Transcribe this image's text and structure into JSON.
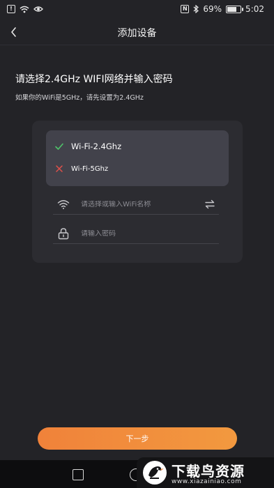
{
  "status_bar": {
    "time": "5:02",
    "battery_text": "69%"
  },
  "header": {
    "title": "添加设备"
  },
  "instructions": {
    "heading": "请选择2.4GHz WIFI网络并输入密码",
    "subheading": "如果你的WiFi是5GHz，请先设置为2.4GHz"
  },
  "network_options": [
    {
      "label": "Wi-Fi-2.4Ghz",
      "status": "supported",
      "icon": "check-icon"
    },
    {
      "label": "Wi-Fi-5Ghz",
      "status": "unsupported",
      "icon": "cross-icon"
    }
  ],
  "form": {
    "wifi_placeholder": "请选择或输入WiFi名称",
    "password_placeholder": "请输入密码"
  },
  "actions": {
    "next_label": "下一步"
  },
  "watermark": {
    "text": "下载鸟资源",
    "url": "www.xiazainiao.com"
  },
  "colors": {
    "background": "#232327",
    "card": "#2c2c31",
    "dropdown": "#42424b",
    "accent_start": "#f0823a",
    "accent_end": "#f2993f",
    "check": "#4fc36a",
    "cross": "#e0504a"
  }
}
